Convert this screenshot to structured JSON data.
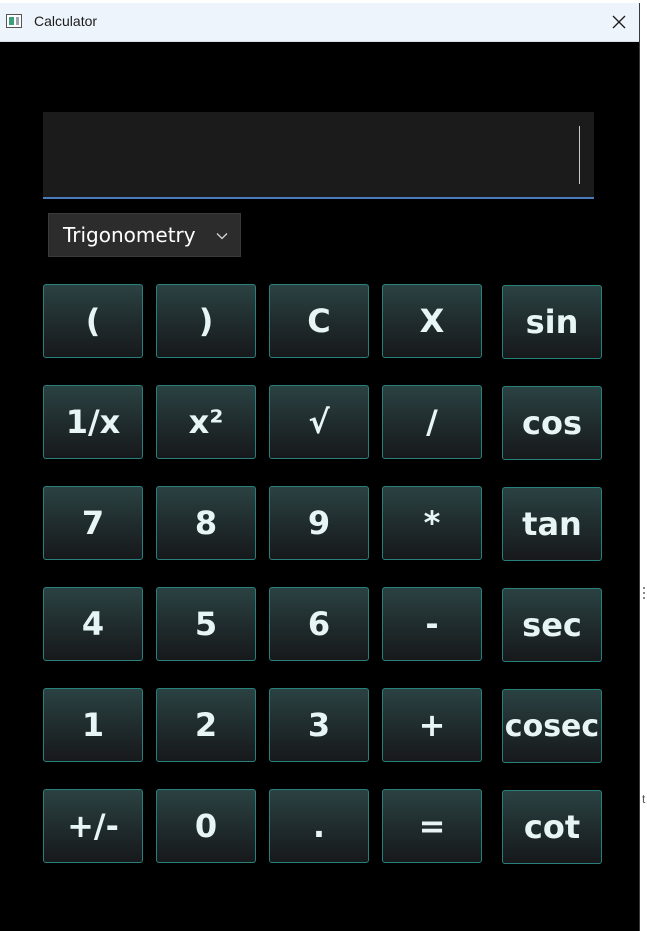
{
  "window": {
    "title": "Calculator"
  },
  "display": {
    "value": ""
  },
  "mode": {
    "selected": "Trigonometry"
  },
  "buttons": [
    {
      "id": "open-paren",
      "label": "("
    },
    {
      "id": "close-paren",
      "label": ")"
    },
    {
      "id": "clear",
      "label": "C"
    },
    {
      "id": "delete",
      "label": "X"
    },
    {
      "id": "sin",
      "label": "sin"
    },
    {
      "id": "reciprocal",
      "label": "1/x"
    },
    {
      "id": "square",
      "label": "x²"
    },
    {
      "id": "sqrt",
      "label": "√"
    },
    {
      "id": "divide",
      "label": "/"
    },
    {
      "id": "cos",
      "label": "cos"
    },
    {
      "id": "digit-7",
      "label": "7"
    },
    {
      "id": "digit-8",
      "label": "8"
    },
    {
      "id": "digit-9",
      "label": "9"
    },
    {
      "id": "multiply",
      "label": "*"
    },
    {
      "id": "tan",
      "label": "tan"
    },
    {
      "id": "digit-4",
      "label": "4"
    },
    {
      "id": "digit-5",
      "label": "5"
    },
    {
      "id": "digit-6",
      "label": "6"
    },
    {
      "id": "subtract",
      "label": "-"
    },
    {
      "id": "sec",
      "label": "sec"
    },
    {
      "id": "digit-1",
      "label": "1"
    },
    {
      "id": "digit-2",
      "label": "2"
    },
    {
      "id": "digit-3",
      "label": "3"
    },
    {
      "id": "add",
      "label": "+"
    },
    {
      "id": "cosec",
      "label": "cosec"
    },
    {
      "id": "negate",
      "label": "+/-"
    },
    {
      "id": "digit-0",
      "label": "0"
    },
    {
      "id": "decimal",
      "label": "."
    },
    {
      "id": "equals",
      "label": "="
    },
    {
      "id": "cot",
      "label": "cot"
    }
  ],
  "background_peek": {
    "text": "t"
  },
  "colors": {
    "button_border": "#27807c",
    "button_text": "#e7f5f5",
    "display_bg": "#1b1b1b",
    "display_underline": "#4c7bbd",
    "window_bg": "#000000"
  }
}
